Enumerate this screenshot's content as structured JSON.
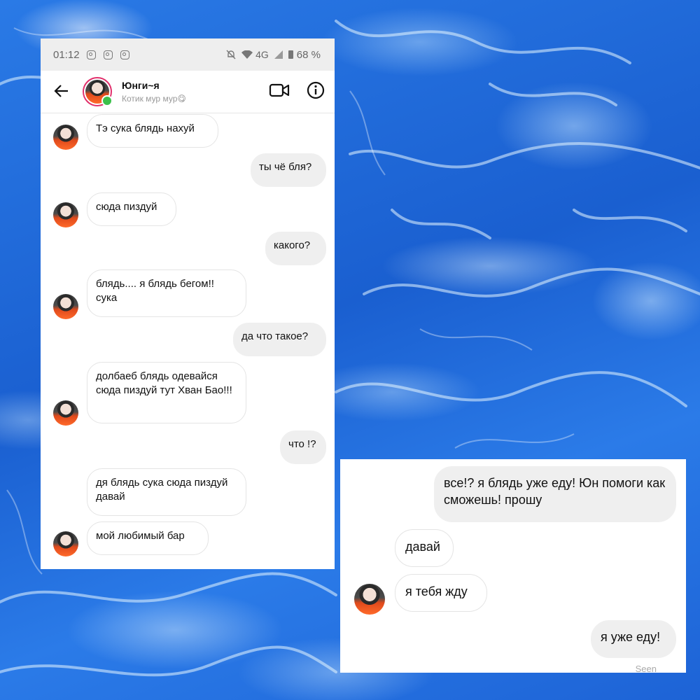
{
  "status_bar": {
    "time": "01:12",
    "network": "4G",
    "battery": "68 %"
  },
  "chat_header": {
    "name": "Юнги~я",
    "status": "Котик мур мур😋"
  },
  "messages": [
    {
      "side": "in",
      "text": "Тэ сука блядь нахуй"
    },
    {
      "side": "out",
      "text": "ты чё бля?"
    },
    {
      "side": "in",
      "text": "сюда пиздуй"
    },
    {
      "side": "out",
      "text": "какого?"
    },
    {
      "side": "in",
      "text": "блядь.... я блядь бегом!! сука"
    },
    {
      "side": "out",
      "text": "да что такое?"
    },
    {
      "side": "in",
      "text": "долбаеб блядь одевайся сюда пиздуй тут Хван Бао!!!"
    },
    {
      "side": "out",
      "text": "что !?"
    },
    {
      "side": "in",
      "text": "дя блядь сука сюда пиздуй давай"
    },
    {
      "side": "in",
      "text": "мой любимый бар"
    }
  ],
  "panel2": {
    "messages": [
      {
        "side": "out",
        "text": "все!? я блядь уже еду! Юн помоги как сможешь! прошу"
      },
      {
        "side": "in",
        "text": "давай"
      },
      {
        "side": "in",
        "text": "я тебя жду"
      },
      {
        "side": "out",
        "text": "я уже еду!"
      }
    ],
    "seen_label": "Seen"
  }
}
